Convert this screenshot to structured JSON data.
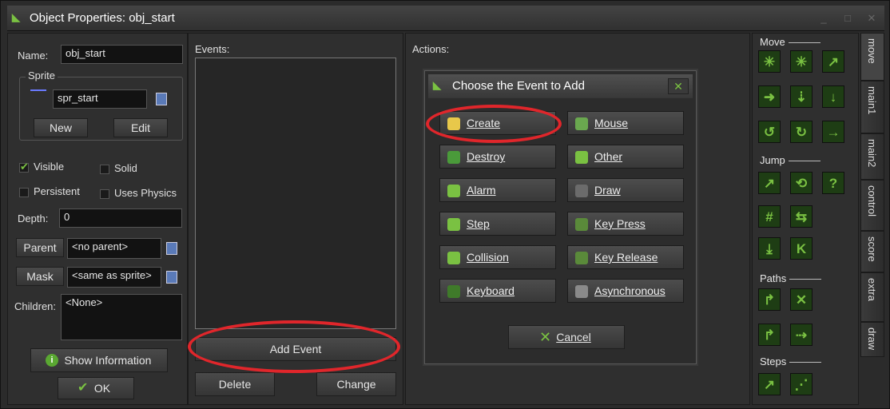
{
  "window": {
    "title": "Object Properties: obj_start",
    "min": "_",
    "max": "□",
    "close": "✕"
  },
  "left": {
    "name_label": "Name:",
    "name_value": "obj_start",
    "sprite_group": "Sprite",
    "sprite_value": "spr_start",
    "new_btn": "New",
    "edit_btn": "Edit",
    "visible": "Visible",
    "solid": "Solid",
    "persistent": "Persistent",
    "uses_physics": "Uses Physics",
    "depth_label": "Depth:",
    "depth_value": "0",
    "parent_btn": "Parent",
    "parent_value": "<no parent>",
    "mask_btn": "Mask",
    "mask_value": "<same as sprite>",
    "children_label": "Children:",
    "children_value": "<None>",
    "show_info": "Show Information",
    "ok": "OK"
  },
  "events": {
    "label": "Events:",
    "add": "Add Event",
    "delete": "Delete",
    "change": "Change"
  },
  "actions": {
    "label": "Actions:"
  },
  "dialog": {
    "title": "Choose the Event to Add",
    "buttons": [
      {
        "label": "Create",
        "color": "#e8c84a"
      },
      {
        "label": "Mouse",
        "color": "#6aa84f"
      },
      {
        "label": "Destroy",
        "color": "#4a9a3a"
      },
      {
        "label": "Other",
        "color": "#7ac142"
      },
      {
        "label": "Alarm",
        "color": "#7ac142"
      },
      {
        "label": "Draw",
        "color": "#6b6b6b"
      },
      {
        "label": "Step",
        "color": "#7ac142"
      },
      {
        "label": "Key Press",
        "color": "#5a8a3a"
      },
      {
        "label": "Collision",
        "color": "#7ac142"
      },
      {
        "label": "Key Release",
        "color": "#5a8a3a"
      },
      {
        "label": "Keyboard",
        "color": "#3f7a2a"
      },
      {
        "label": "Asynchronous",
        "color": "#8a8a8a"
      }
    ],
    "cancel": "Cancel"
  },
  "toolbox": {
    "move": "Move",
    "jump": "Jump",
    "paths": "Paths",
    "steps": "Steps"
  },
  "tabs": [
    "move",
    "main1",
    "main2",
    "control",
    "score",
    "extra",
    "draw"
  ]
}
